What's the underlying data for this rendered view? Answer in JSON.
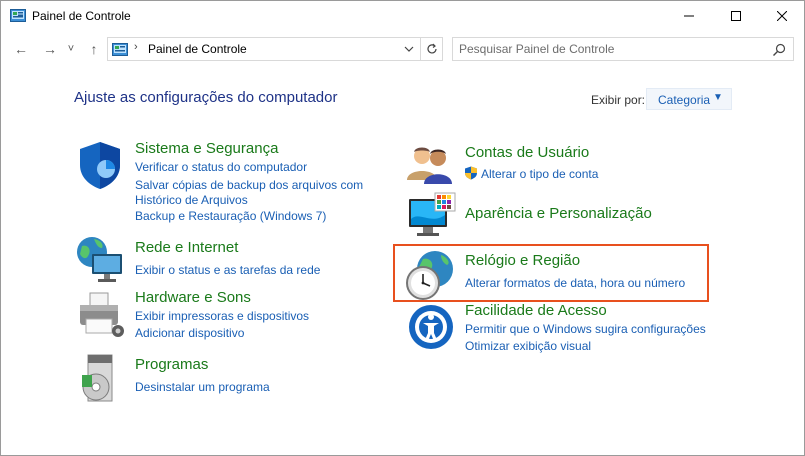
{
  "window": {
    "title": "Painel de Controle"
  },
  "nav": {
    "back_label": "←",
    "forward_label": "→",
    "recent_label": "˅",
    "up_label": "↑",
    "breadcrumb_sep": "›",
    "address": "Painel de Controle",
    "search_placeholder": "Pesquisar Painel de Controle"
  },
  "content": {
    "heading": "Ajuste as configurações do computador",
    "view_by_label": "Exibir por:",
    "view_by_value": "Categoria"
  },
  "categories": {
    "system": {
      "title": "Sistema e Segurança",
      "links": [
        "Verificar o status do computador",
        "Salvar cópias de backup dos arquivos com",
        "Histórico de Arquivos",
        "Backup e Restauração (Windows 7)"
      ]
    },
    "network": {
      "title": "Rede e Internet",
      "links": [
        "Exibir o status e as tarefas da rede"
      ]
    },
    "hardware": {
      "title": "Hardware e Sons",
      "links": [
        "Exibir impressoras e dispositivos",
        "Adicionar dispositivo"
      ]
    },
    "programs": {
      "title": "Programas",
      "links": [
        "Desinstalar um programa"
      ]
    },
    "accounts": {
      "title": "Contas de Usuário",
      "links": [
        "Alterar o tipo de conta"
      ]
    },
    "appearance": {
      "title": "Aparência e Personalização",
      "links": []
    },
    "clock": {
      "title": "Relógio e Região",
      "links": [
        "Alterar formatos de data, hora ou número"
      ]
    },
    "ease": {
      "title": "Facilidade de Acesso",
      "links": [
        "Permitir que o Windows sugira configurações",
        "Otimizar exibição visual"
      ]
    }
  },
  "colors": {
    "heading": "#1e3287",
    "category_title": "#1a7a1a",
    "link": "#1a5fb4",
    "highlight": "#e8501e"
  },
  "icons": {
    "title": "control-panel-icon",
    "system": "shield-icon",
    "network": "globe-monitor-icon",
    "hardware": "printer-icon",
    "programs": "programs-disc-icon",
    "accounts": "users-icon",
    "appearance": "monitor-palette-icon",
    "clock": "clock-globe-icon",
    "ease": "accessibility-icon"
  }
}
